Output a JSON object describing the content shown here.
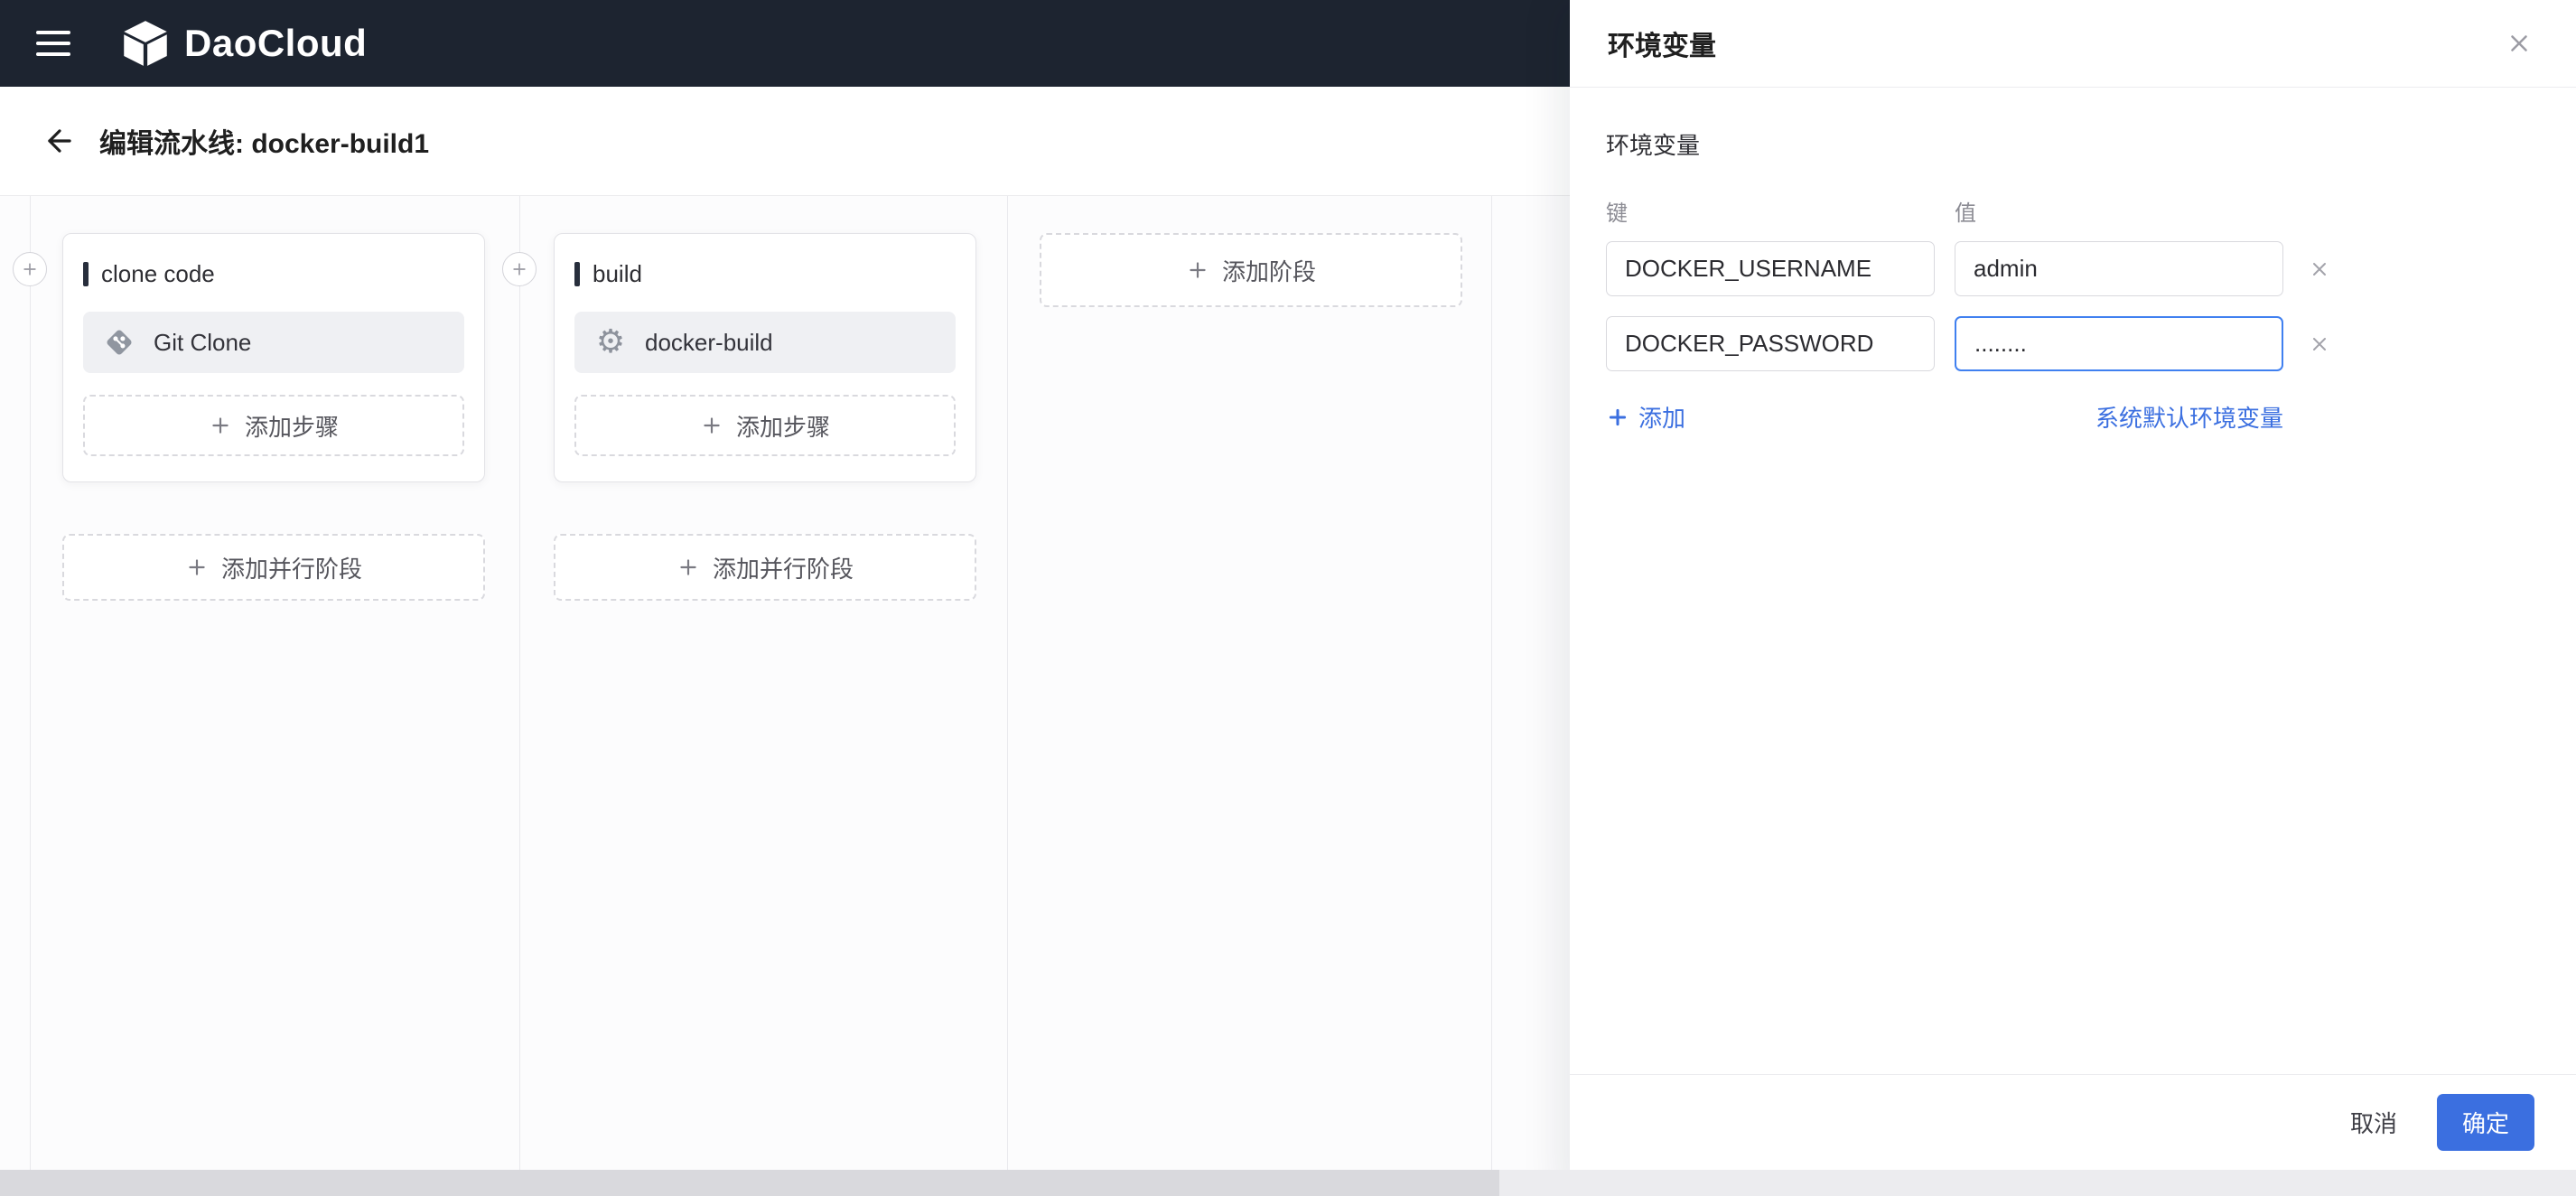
{
  "colors": {
    "accent": "#3b6fe0",
    "topbar_bg": "#1d2430"
  },
  "header": {
    "brand": "DaoCloud"
  },
  "page": {
    "title": "编辑流水线: docker-build1"
  },
  "pipeline": {
    "stages": [
      {
        "name": "clone code",
        "steps": [
          {
            "icon": "git",
            "label": "Git Clone"
          }
        ],
        "add_step_label": "添加步骤",
        "add_parallel_label": "添加并行阶段"
      },
      {
        "name": "build",
        "steps": [
          {
            "icon": "gear",
            "label": "docker-build"
          }
        ],
        "add_step_label": "添加步骤",
        "add_parallel_label": "添加并行阶段"
      }
    ],
    "add_stage_label": "添加阶段"
  },
  "icons": {
    "gear_glyph": "⚙"
  },
  "drawer": {
    "title": "环境变量",
    "section_label": "环境变量",
    "columns": {
      "key": "键",
      "value": "值"
    },
    "rows": [
      {
        "key": "DOCKER_USERNAME",
        "value": "admin"
      },
      {
        "key": "DOCKER_PASSWORD",
        "value": "........"
      }
    ],
    "add_label": "添加",
    "system_default_label": "系统默认环境变量",
    "footer": {
      "cancel": "取消",
      "confirm": "确定"
    }
  }
}
